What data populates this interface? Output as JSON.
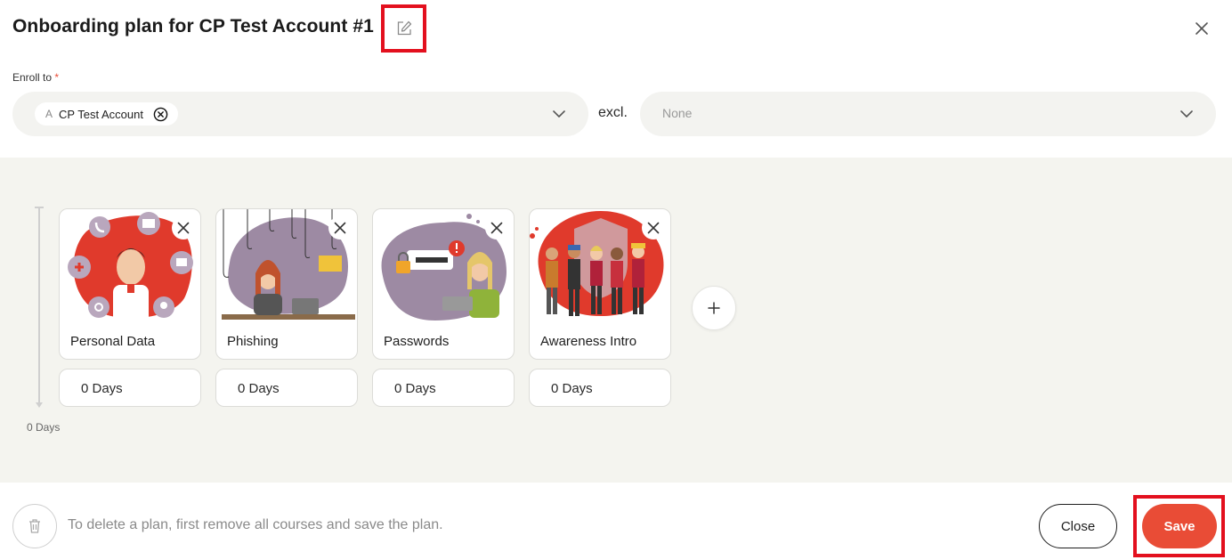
{
  "header": {
    "title": "Onboarding plan for CP Test Account #1",
    "edit_icon": "edit-icon",
    "close_icon": "close-icon"
  },
  "enroll": {
    "label": "Enroll to",
    "required_mark": "*",
    "chip_prefix": "A",
    "chip_label": "CP Test Account",
    "excl_label": "excl.",
    "exclude_placeholder": "None"
  },
  "courses": [
    {
      "title": "Personal Data",
      "days": "0 Days"
    },
    {
      "title": "Phishing",
      "days": "0 Days"
    },
    {
      "title": "Passwords",
      "days": "0 Days"
    },
    {
      "title": "Awareness Intro",
      "days": "0 Days"
    }
  ],
  "timeline": {
    "label": "0 Days"
  },
  "footer": {
    "delete_note": "To delete a plan, first remove all courses and save the plan.",
    "close_label": "Close",
    "save_label": "Save"
  },
  "colors": {
    "accent": "#e94c36",
    "highlight": "#e3101e",
    "board_bg": "#f4f4ef",
    "illustration_purple": "#9d8aa3",
    "illustration_red": "#e03a2c"
  }
}
